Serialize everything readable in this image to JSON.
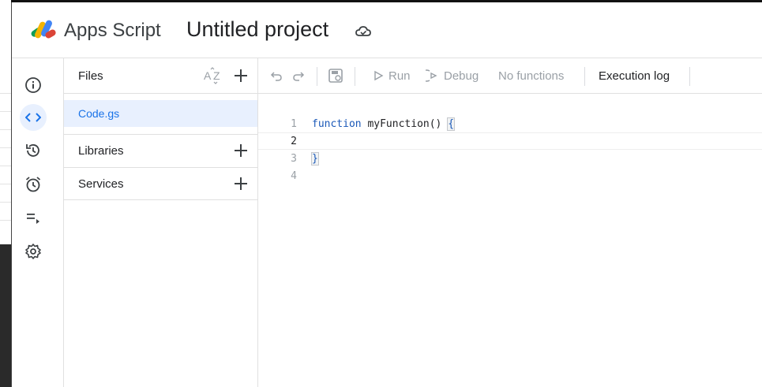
{
  "header": {
    "product_name": "Apps Script",
    "project_title": "Untitled project",
    "logo_icon": "apps-script-logo",
    "cloud_icon": "cloud-saved-icon"
  },
  "rail": {
    "items": [
      {
        "name": "overview",
        "icon": "info-icon",
        "active": false
      },
      {
        "name": "editor",
        "icon": "code-icon",
        "active": true
      },
      {
        "name": "project-history",
        "icon": "history-icon",
        "active": false
      },
      {
        "name": "triggers",
        "icon": "alarm-icon",
        "active": false
      },
      {
        "name": "executions",
        "icon": "executions-icon",
        "active": false
      },
      {
        "name": "project-settings",
        "icon": "gear-icon",
        "active": false
      }
    ]
  },
  "files": {
    "title": "Files",
    "sort_icon": "sort-az-icon",
    "items": [
      {
        "name": "Code.gs",
        "selected": true
      }
    ],
    "sections": [
      {
        "label": "Libraries"
      },
      {
        "label": "Services"
      }
    ]
  },
  "toolbar": {
    "run_label": "Run",
    "debug_label": "Debug",
    "function_select": "No functions",
    "execution_log_label": "Execution log"
  },
  "editor": {
    "lines": [
      {
        "num": "1",
        "keyword": "function",
        "text": " myFunction() ",
        "brace": "{"
      },
      {
        "num": "2",
        "keyword": "",
        "text": "",
        "brace": ""
      },
      {
        "num": "3",
        "keyword": "",
        "text": "",
        "brace": "}"
      },
      {
        "num": "4",
        "keyword": "",
        "text": "",
        "brace": ""
      }
    ]
  },
  "colors": {
    "accent": "#1a73e8",
    "active_bg": "#e8f0fe",
    "muted": "#9aa0a6"
  }
}
